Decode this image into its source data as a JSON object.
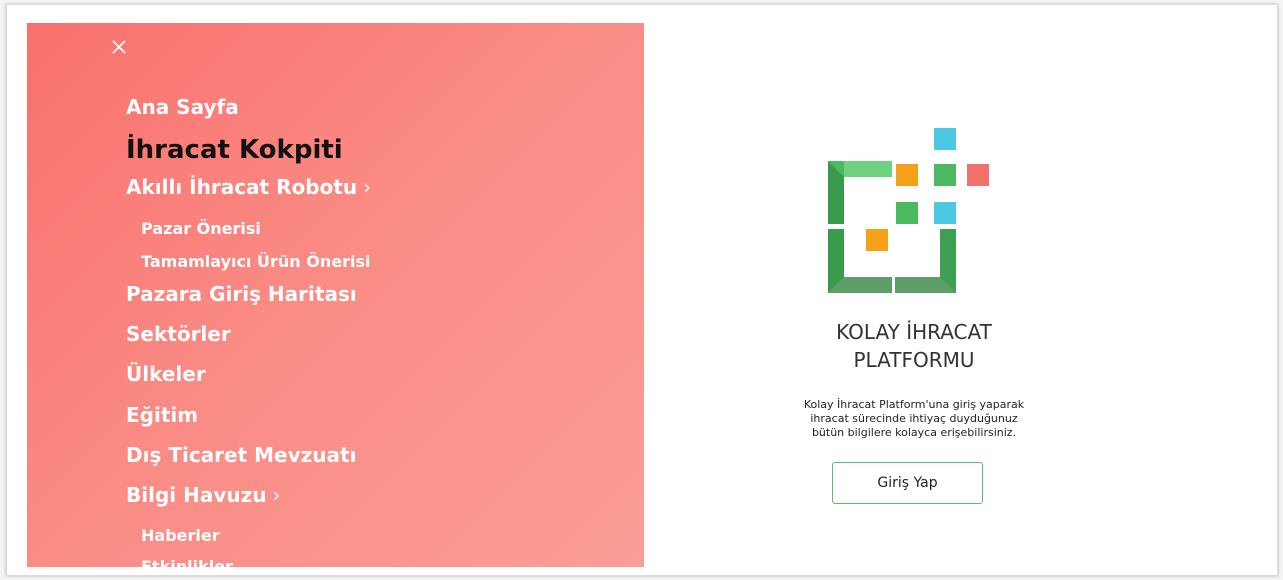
{
  "menu": {
    "close_icon": "close-icon",
    "background_colors": [
      "#f9706d",
      "#fb9e97"
    ],
    "items": [
      {
        "label": "Ana Sayfa"
      },
      {
        "label": "İhracat Kokpiti",
        "active": true
      },
      {
        "label": "Akıllı İhracat Robotu",
        "has_children": true
      },
      {
        "label": "Pazar Önerisi",
        "level": 2
      },
      {
        "label": "Tamamlayıcı Ürün Önerisi",
        "level": 2
      },
      {
        "label": "Pazara Giriş Haritası"
      },
      {
        "label": "Sektörler"
      },
      {
        "label": "Ülkeler"
      },
      {
        "label": "Eğitim"
      },
      {
        "label": "Dış Ticaret Mevzuatı"
      },
      {
        "label": "Bilgi Havuzu",
        "has_children": true
      },
      {
        "label": "Haberler",
        "level": 2
      },
      {
        "label": "Etkinlikler",
        "level": 2
      }
    ],
    "chevron_glyph": "›"
  },
  "brand": {
    "line1": "KOLAY İHRACAT",
    "line2": "PLATFORMU",
    "logo_colors": {
      "green": "#4cb860",
      "light_green": "#6fd07f",
      "dark_green": "#3a9a4e",
      "orange": "#f5a117",
      "blue": "#4dc8e3",
      "red": "#f0726b"
    }
  },
  "description": {
    "line1": "Kolay İhracat Platform'una giriş yaparak",
    "line2": "ihracat sürecinde ihtiyaç duyduğunuz",
    "line3": "bütün bilgilere kolayca erişebilirsiniz."
  },
  "login_button": {
    "label": "Giriş Yap",
    "border_color": "#5bbf72"
  }
}
